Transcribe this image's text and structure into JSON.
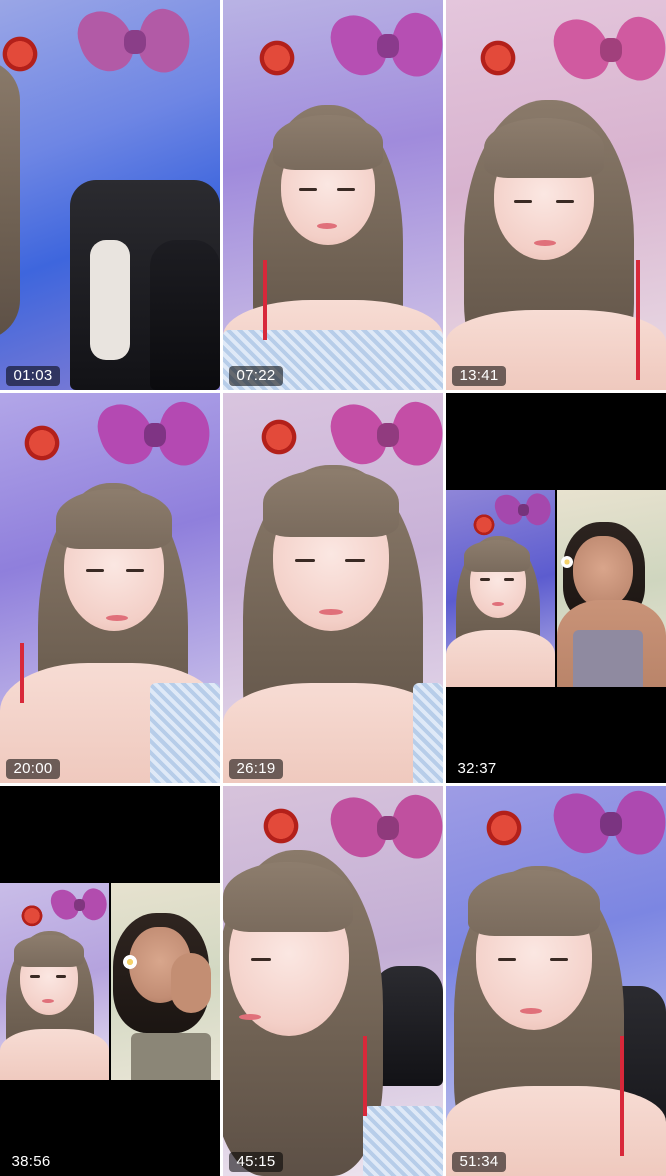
{
  "videos": [
    {
      "duration": "01:03",
      "scene": "chair"
    },
    {
      "duration": "07:22",
      "scene": "portrait"
    },
    {
      "duration": "13:41",
      "scene": "portrait"
    },
    {
      "duration": "20:00",
      "scene": "portrait"
    },
    {
      "duration": "26:19",
      "scene": "portrait"
    },
    {
      "duration": "32:37",
      "scene": "split"
    },
    {
      "duration": "38:56",
      "scene": "split"
    },
    {
      "duration": "45:15",
      "scene": "portrait"
    },
    {
      "duration": "51:34",
      "scene": "portrait"
    }
  ],
  "colors": {
    "background": "#ffffff",
    "tile_background": "#000000",
    "badge_background": "#00000080",
    "badge_text": "#ffffff",
    "bow": "#c24a9a",
    "wall_light": "#8d86d6"
  },
  "icons": [
    "play-thumbnail-icon"
  ]
}
